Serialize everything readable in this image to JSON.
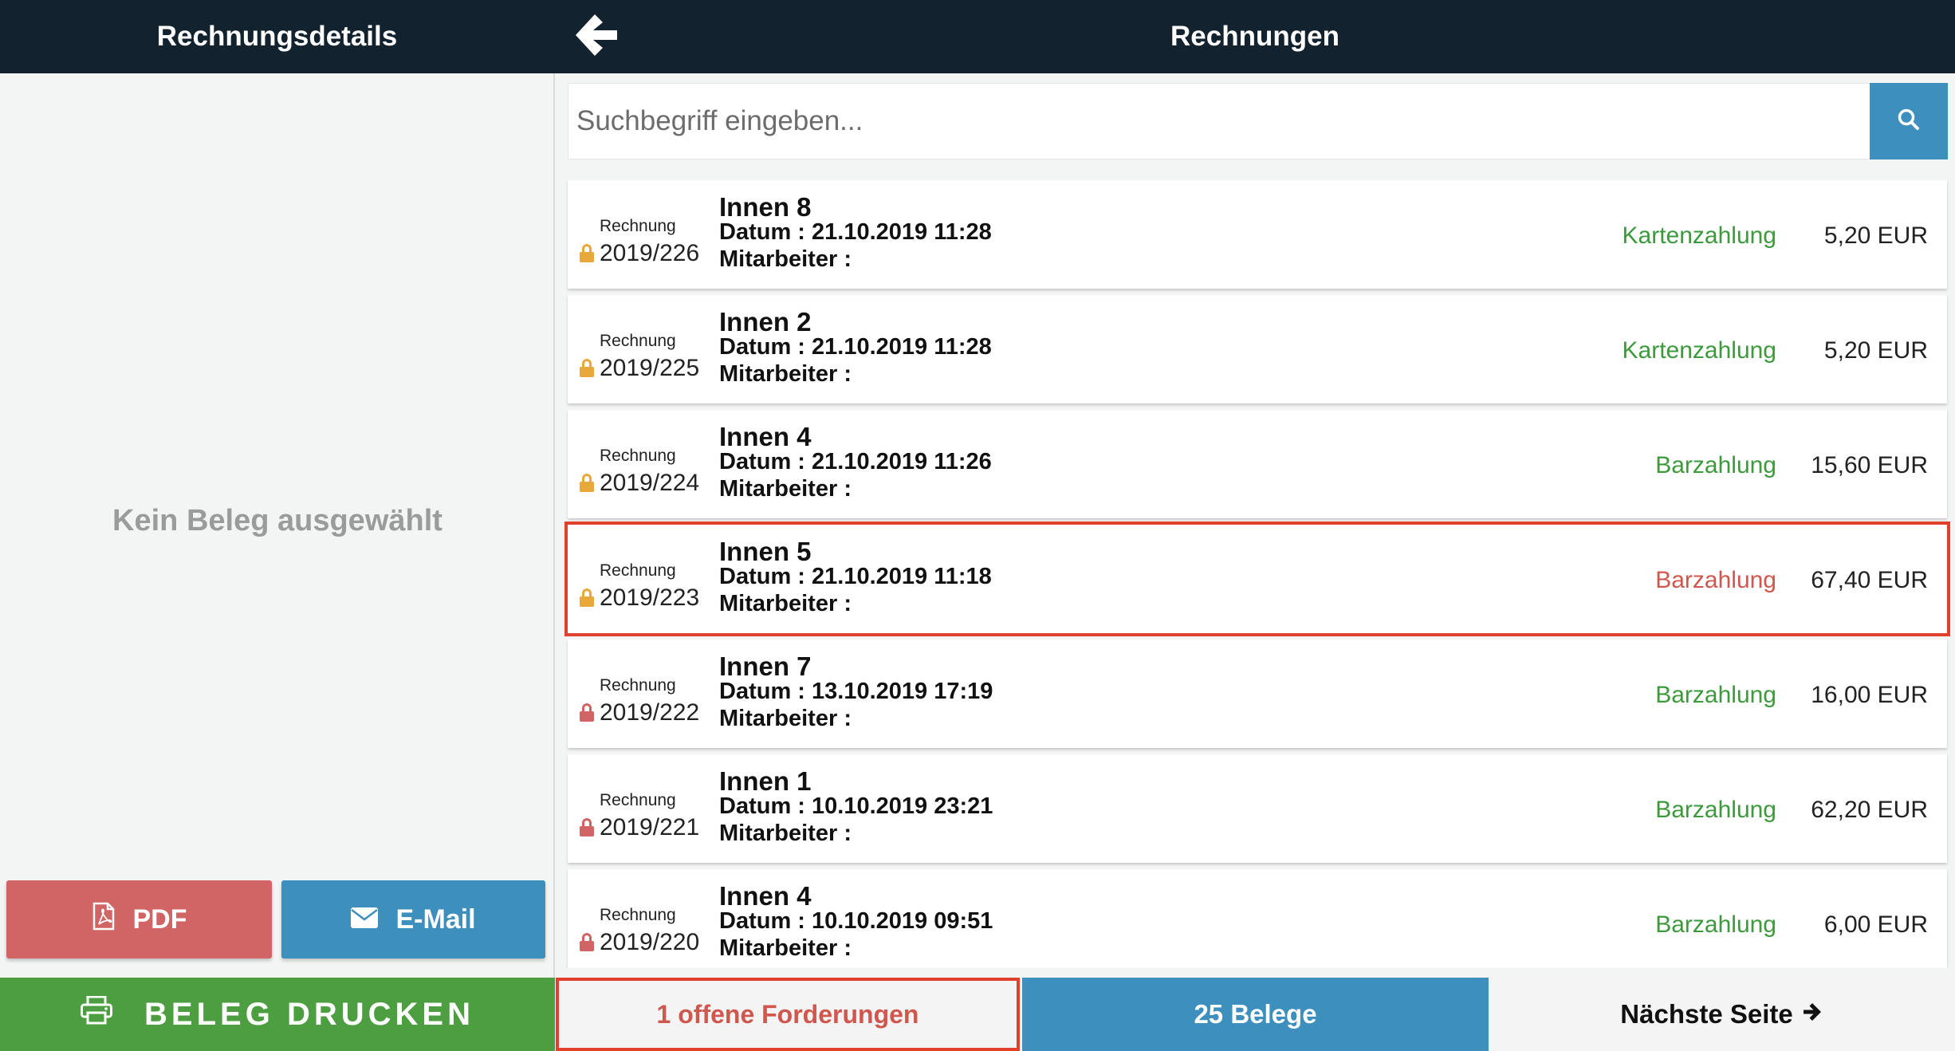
{
  "header": {
    "left_title": "Rechnungsdetails",
    "right_title": "Rechnungen"
  },
  "details": {
    "empty_message": "Kein Beleg ausgewählt",
    "pdf_label": "PDF",
    "email_label": "E-Mail"
  },
  "search": {
    "placeholder": "Suchbegriff eingeben..."
  },
  "invoices": [
    {
      "label": "Rechnung",
      "number": "2019/226",
      "name": "Innen 8",
      "datum": "Datum : 21.10.2019 11:28",
      "mitarbeiter": "Mitarbeiter :",
      "payment": "Kartenzahlung",
      "amount": "5,20 EUR",
      "lock_color": "#e8a83a",
      "payment_color": "#3c9a3c",
      "selected": false
    },
    {
      "label": "Rechnung",
      "number": "2019/225",
      "name": "Innen 2",
      "datum": "Datum : 21.10.2019 11:28",
      "mitarbeiter": "Mitarbeiter :",
      "payment": "Kartenzahlung",
      "amount": "5,20 EUR",
      "lock_color": "#e8a83a",
      "payment_color": "#3c9a3c",
      "selected": false
    },
    {
      "label": "Rechnung",
      "number": "2019/224",
      "name": "Innen 4",
      "datum": "Datum : 21.10.2019 11:26",
      "mitarbeiter": "Mitarbeiter :",
      "payment": "Barzahlung",
      "amount": "15,60 EUR",
      "lock_color": "#e8a83a",
      "payment_color": "#3c9a3c",
      "selected": false
    },
    {
      "label": "Rechnung",
      "number": "2019/223",
      "name": "Innen 5",
      "datum": "Datum : 21.10.2019 11:18",
      "mitarbeiter": "Mitarbeiter :",
      "payment": "Barzahlung",
      "amount": "67,40 EUR",
      "lock_color": "#e8a83a",
      "payment_color": "#d0574d",
      "selected": true
    },
    {
      "label": "Rechnung",
      "number": "2019/222",
      "name": "Innen 7",
      "datum": "Datum : 13.10.2019 17:19",
      "mitarbeiter": "Mitarbeiter :",
      "payment": "Barzahlung",
      "amount": "16,00 EUR",
      "lock_color": "#d16464",
      "payment_color": "#3c9a3c",
      "selected": false
    },
    {
      "label": "Rechnung",
      "number": "2019/221",
      "name": "Innen 1",
      "datum": "Datum : 10.10.2019 23:21",
      "mitarbeiter": "Mitarbeiter :",
      "payment": "Barzahlung",
      "amount": "62,20 EUR",
      "lock_color": "#d16464",
      "payment_color": "#3c9a3c",
      "selected": false
    },
    {
      "label": "Rechnung",
      "number": "2019/220",
      "name": "Innen 4",
      "datum": "Datum : 10.10.2019 09:51",
      "mitarbeiter": "Mitarbeiter :",
      "payment": "Barzahlung",
      "amount": "6,00 EUR",
      "lock_color": "#d16464",
      "payment_color": "#3c9a3c",
      "selected": false
    }
  ],
  "footer": {
    "print_label": "BELEG DRUCKEN",
    "open_claims": "1 offene Forderungen",
    "count": "25 Belege",
    "next_page": "Nächste Seite"
  },
  "colors": {
    "header_bg": "#13222f",
    "accent_blue": "#3d8fbd",
    "pdf_red": "#d16464",
    "print_green": "#4c9e40",
    "highlight_red": "#e0402c"
  }
}
